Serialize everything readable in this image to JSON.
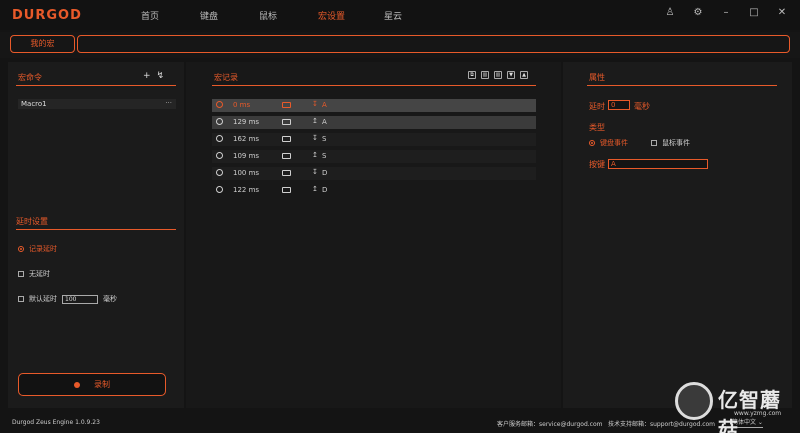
{
  "app": {
    "logo": "DURGOD",
    "nav": [
      "首页",
      "键盘",
      "鼠标",
      "宏设置",
      "星云"
    ],
    "active_nav": "宏设置"
  },
  "tabs": {
    "my_macro": "我的宏"
  },
  "left": {
    "macro_cmd_title": "宏命令",
    "add_icon": "+",
    "import_icon": "↯",
    "macros": [
      {
        "name": "Macro1",
        "menu": "···"
      }
    ],
    "delay_title": "延时设置",
    "delay_options": [
      "记录延时",
      "无延时",
      "默认延时"
    ],
    "default_delay_value": "100",
    "delay_unit": "毫秒",
    "record_label": "录制"
  },
  "middle": {
    "title": "宏记录",
    "rows": [
      {
        "ms": "0 ms",
        "dir": "↧",
        "key": "A"
      },
      {
        "ms": "129 ms",
        "dir": "↥",
        "key": "A"
      },
      {
        "ms": "162 ms",
        "dir": "↧",
        "key": "S"
      },
      {
        "ms": "109 ms",
        "dir": "↥",
        "key": "S"
      },
      {
        "ms": "100 ms",
        "dir": "↧",
        "key": "D"
      },
      {
        "ms": "122 ms",
        "dir": "↥",
        "key": "D"
      }
    ]
  },
  "right": {
    "title": "属性",
    "delay_label": "延时",
    "delay_value": "0",
    "delay_unit": "毫秒",
    "type_label": "类型",
    "type_options": [
      "键盘事件",
      "鼠标事件"
    ],
    "key_label": "按键",
    "key_value": "A"
  },
  "footer": {
    "version": "Durgod Zeus Engine 1.0.9.23",
    "service": "客户服务邮箱：service@durgod.com",
    "support": "技术支持邮箱：support@durgod.com",
    "language": "简体中文 ⌄"
  },
  "watermark": {
    "text": "亿智蘑菇",
    "url": "www.yzmg.com"
  },
  "colors": {
    "accent": "#e85a2a",
    "bg": "#141414"
  }
}
